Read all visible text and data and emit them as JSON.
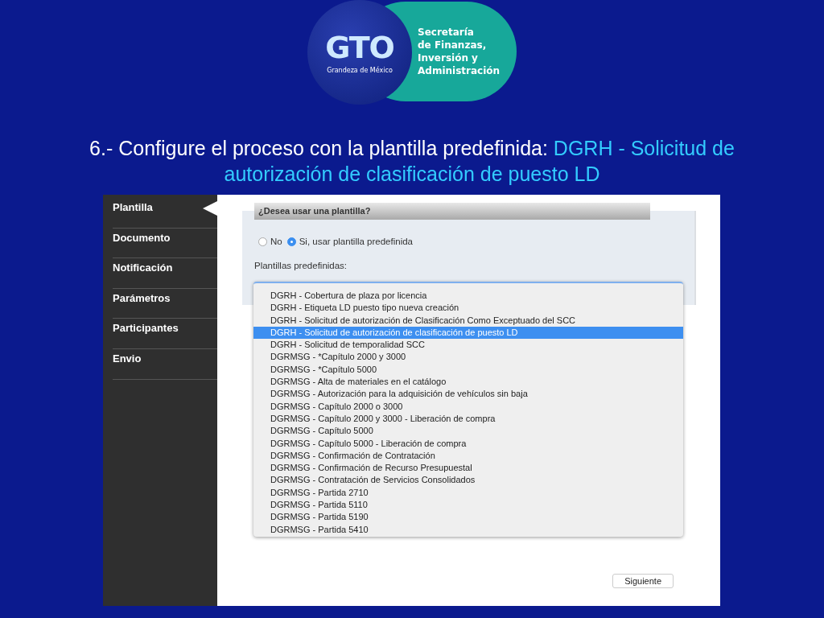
{
  "logo": {
    "mark": "GTO",
    "tagline": "Grandeza de México",
    "org_lines": [
      "Secretaría",
      "de Finanzas,",
      "Inversión y",
      "Administración"
    ]
  },
  "title": {
    "lead": "6.- Configure el proceso con la plantilla predefinida: ",
    "highlight": "DGRH - Solicitud de autorización de clasificación de puesto LD"
  },
  "sidebar": {
    "items": [
      {
        "label": "Plantilla",
        "selected": true
      },
      {
        "label": "Documento",
        "selected": false
      },
      {
        "label": "Notificación",
        "selected": false
      },
      {
        "label": "Parámetros",
        "selected": false
      },
      {
        "label": "Participantes",
        "selected": false
      },
      {
        "label": "Envio",
        "selected": false
      }
    ]
  },
  "section": {
    "header": "¿Desea usar una plantilla?",
    "options": [
      {
        "label": "No",
        "selected": false
      },
      {
        "label": "Si, usar plantilla predefinida",
        "selected": true
      }
    ],
    "list_label": "Plantillas predefinidas:"
  },
  "dropdown": {
    "items": [
      {
        "label": "DGRH - Cobertura de plaza por licencia",
        "selected": false
      },
      {
        "label": "DGRH - Etiqueta LD puesto tipo nueva creación",
        "selected": false
      },
      {
        "label": "DGRH - Solicitud de autorización de Clasificación Como Exceptuado del SCC",
        "selected": false
      },
      {
        "label": "DGRH - Solicitud de autorización de clasificación de puesto LD",
        "selected": true
      },
      {
        "label": "DGRH - Solicitud de temporalidad SCC",
        "selected": false
      },
      {
        "label": "DGRMSG - *Capítulo 2000 y 3000",
        "selected": false
      },
      {
        "label": "DGRMSG - *Capítulo 5000",
        "selected": false
      },
      {
        "label": "DGRMSG - Alta de materiales en el catálogo",
        "selected": false
      },
      {
        "label": "DGRMSG - Autorización para la adquisición de vehículos sin baja",
        "selected": false
      },
      {
        "label": "DGRMSG - Capítulo 2000 o 3000",
        "selected": false
      },
      {
        "label": "DGRMSG - Capítulo 2000 y 3000 - Liberación de compra",
        "selected": false
      },
      {
        "label": "DGRMSG - Capítulo 5000",
        "selected": false
      },
      {
        "label": "DGRMSG - Capítulo 5000 - Liberación de compra",
        "selected": false
      },
      {
        "label": "DGRMSG - Confirmación de Contratación",
        "selected": false
      },
      {
        "label": "DGRMSG - Confirmación de Recurso Presupuestal",
        "selected": false
      },
      {
        "label": "DGRMSG - Contratación de Servicios Consolidados",
        "selected": false
      },
      {
        "label": "DGRMSG - Partida 2710",
        "selected": false
      },
      {
        "label": "DGRMSG - Partida 5110",
        "selected": false
      },
      {
        "label": "DGRMSG - Partida 5190",
        "selected": false
      },
      {
        "label": "DGRMSG - Partida 5410",
        "selected": false
      }
    ]
  },
  "buttons": [
    "Siguiente"
  ]
}
